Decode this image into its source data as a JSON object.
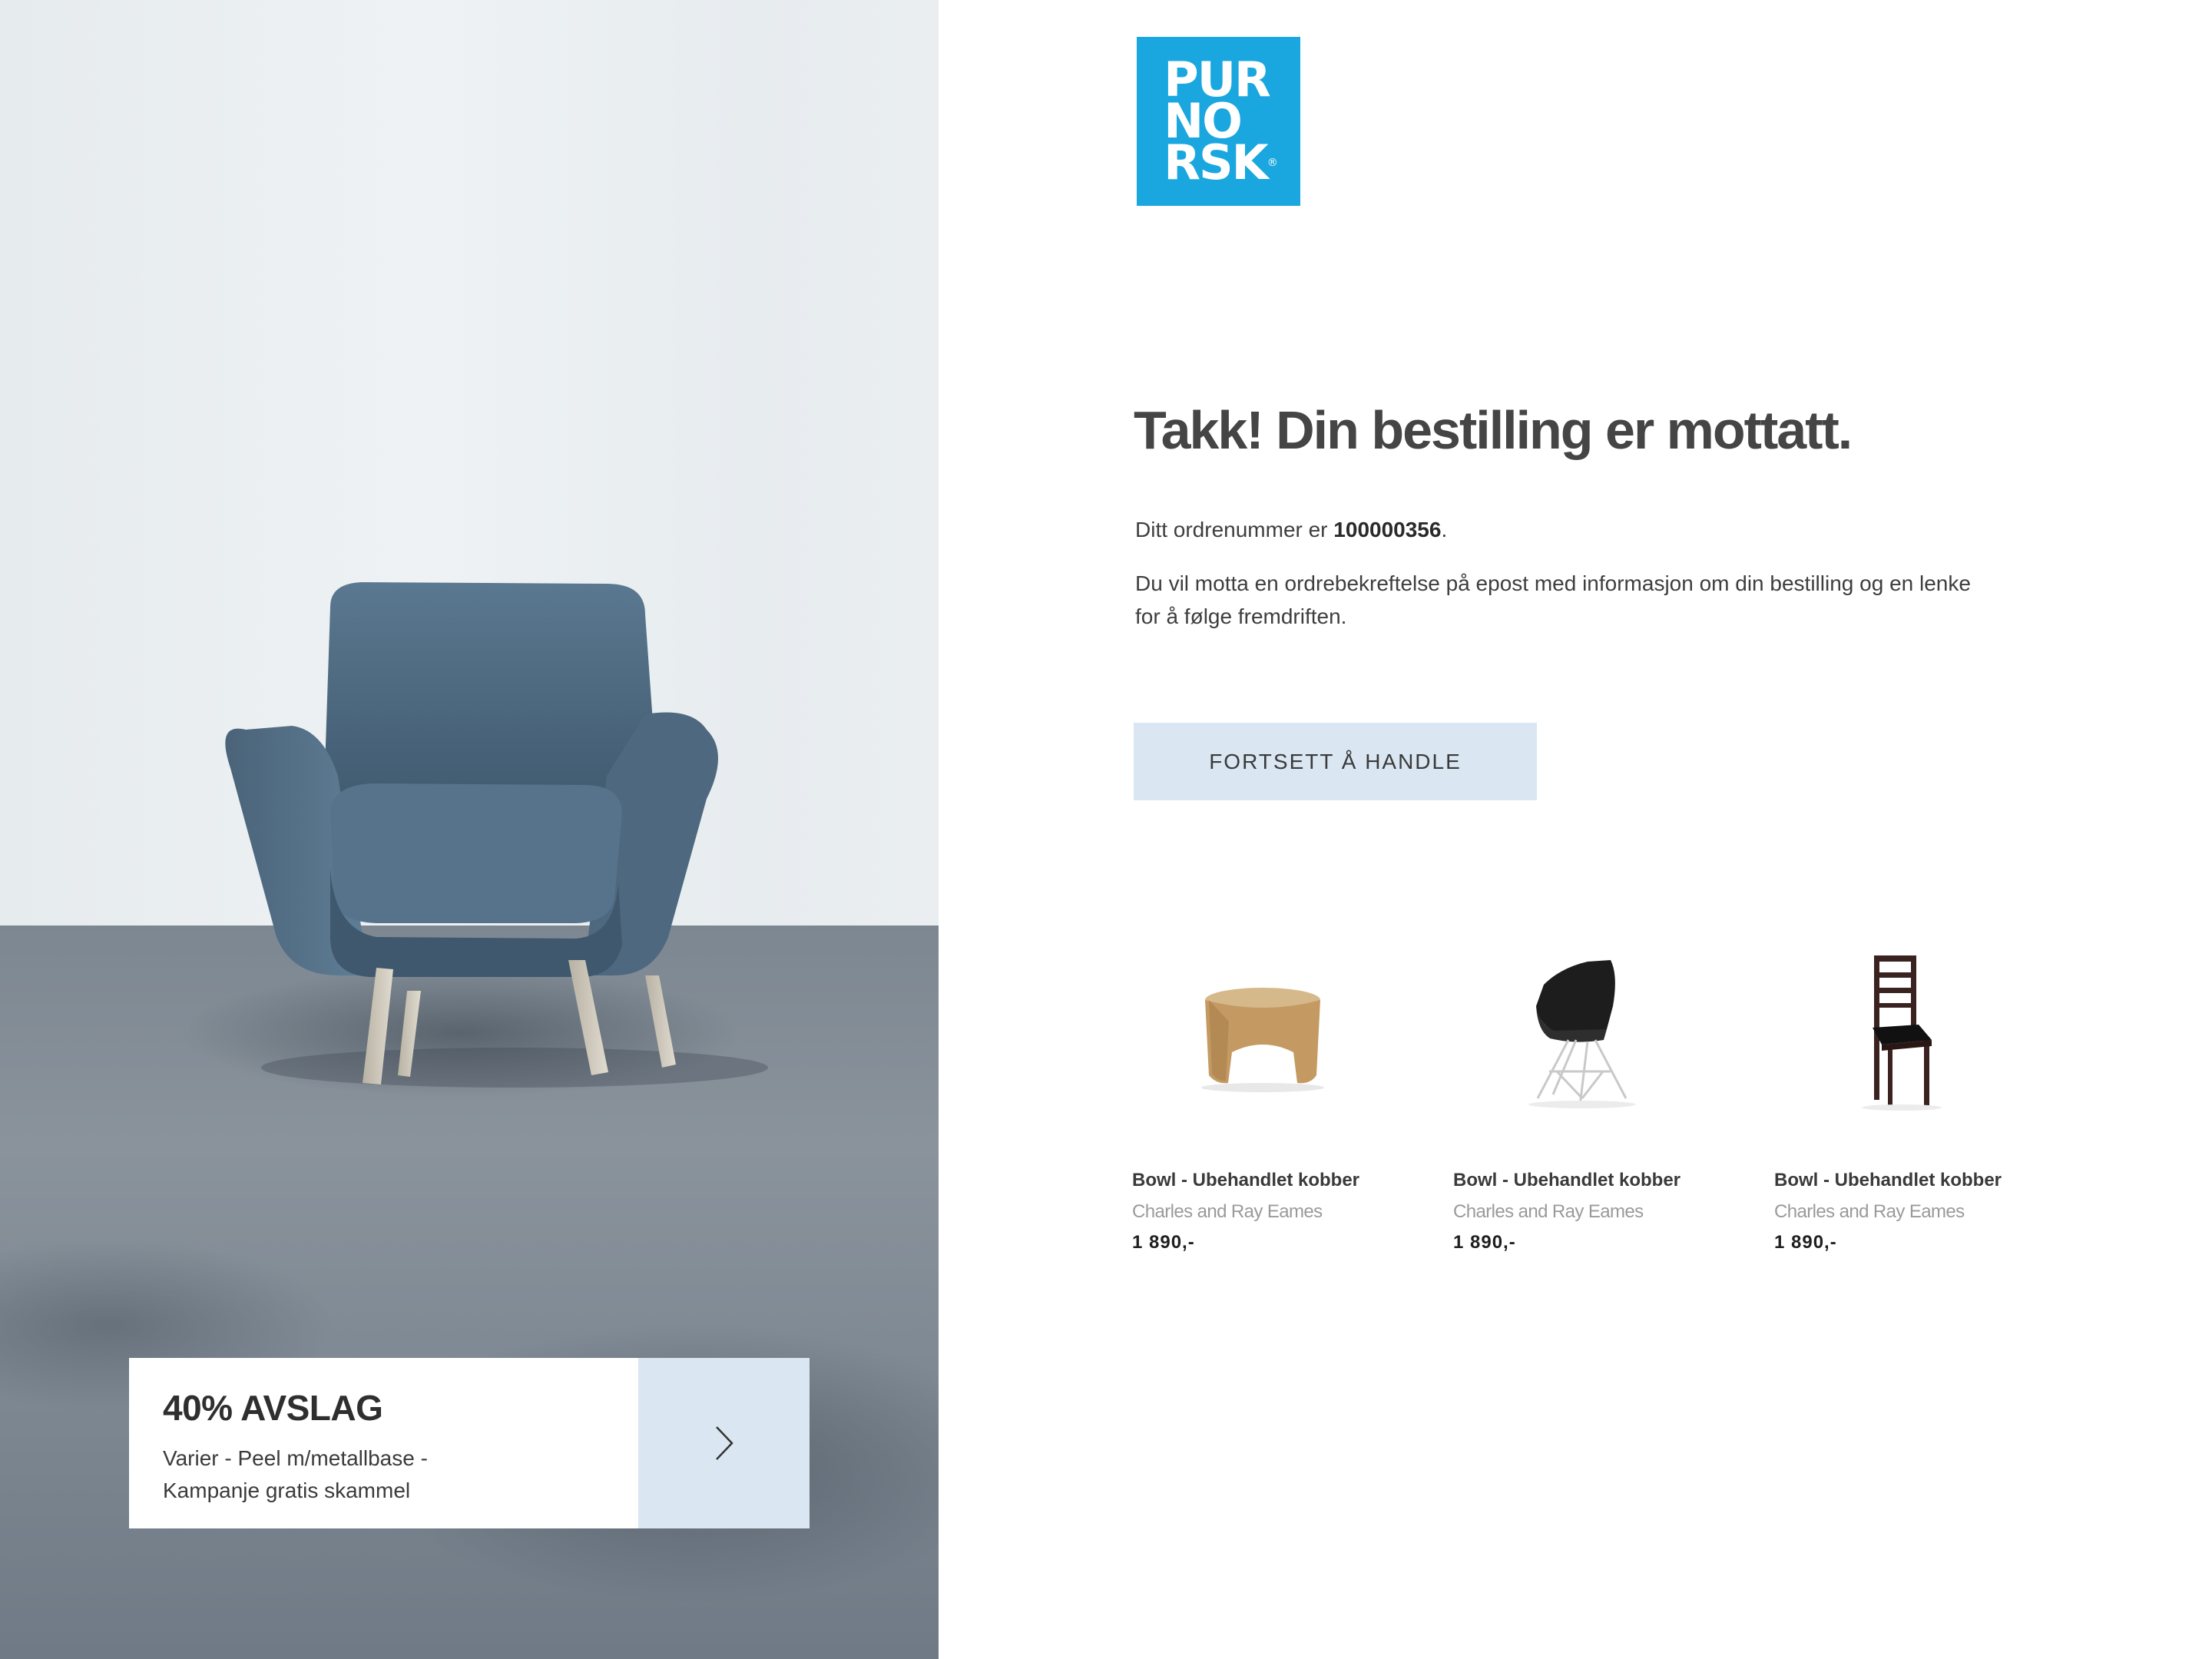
{
  "hero": {
    "image": "armchair-photo",
    "promo": {
      "title": "40% AVSLAG",
      "desc_line1": "Varier - Peel m/metallbase -",
      "desc_line2": "Kampanje gratis skammel",
      "arrow_icon": "chevron-right-icon"
    }
  },
  "logo": {
    "line1": "PUR",
    "line2": "NO",
    "line3": "RSK",
    "reg": "®",
    "color": "#1aa7df"
  },
  "confirmation": {
    "headline": "Takk! Din bestilling er mottatt.",
    "order_prefix": "Ditt ordrenummer er ",
    "order_number": "100000356",
    "order_suffix": ".",
    "info_line1": "Du vil motta en ordrebekreftelse på epost med informasjon om din bestilling og en lenke",
    "info_line2": "for å følge fremdriften."
  },
  "cta": {
    "label": "FORTSETT Å HANDLE",
    "color": "#dae6f1"
  },
  "products": [
    {
      "name": "Bowl - Ubehandlet kobber",
      "brand": "Charles and Ray Eames",
      "price": "1 890,-",
      "image": "wooden-stool-image"
    },
    {
      "name": "Bowl - Ubehandlet kobber",
      "brand": "Charles and Ray Eames",
      "price": "1 890,-",
      "image": "black-shell-chair-image"
    },
    {
      "name": "Bowl - Ubehandlet kobber",
      "brand": "Charles and Ray Eames",
      "price": "1 890,-",
      "image": "wooden-dining-chair-image"
    }
  ]
}
